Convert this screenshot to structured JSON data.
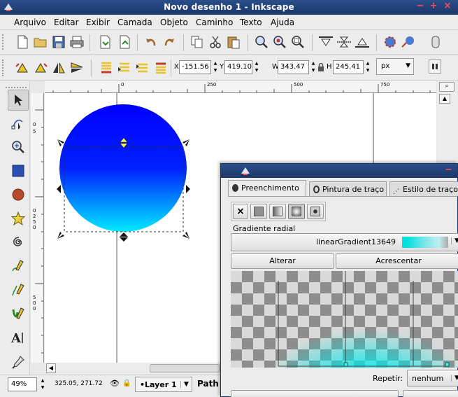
{
  "window": {
    "title": "Novo desenho 1 - Inkscape"
  },
  "menu": [
    "Arquivo",
    "Editar",
    "Exibir",
    "Camada",
    "Objeto",
    "Caminho",
    "Texto",
    "Ajuda"
  ],
  "toolbar2": {
    "x_label": "X",
    "x_value": "-151.56",
    "y_label": "Y",
    "y_value": "419.10",
    "w_label": "W",
    "w_value": "343.47",
    "h_label": "H",
    "h_value": "245.41",
    "unit": "px"
  },
  "ruler": {
    "top": [
      "0",
      "250",
      "500",
      "750"
    ],
    "left": [
      "0",
      "5",
      "0",
      "2",
      "5",
      "0",
      "5",
      "0",
      "0"
    ]
  },
  "colors": {
    "circle_top": "#0000ff",
    "circle_bottom": "#00eaff",
    "titlebar": "#1b3766"
  },
  "status": {
    "zoom": "49%",
    "coords": "325.05, 271.72",
    "layer": "•Layer 1",
    "selection": "Path"
  },
  "dialog": {
    "tabs": [
      "Preenchimento",
      "Pintura de traço",
      "Estilo de traço"
    ],
    "gradient_type_label": "Gradiente radial",
    "gradient_name": "linearGradient13649",
    "edit_button": "Alterar",
    "add_button": "Acrescentar",
    "repeat_label": "Repetir:",
    "repeat_value": "nenhum"
  },
  "icons": {
    "tools": [
      "selector-arrow-icon",
      "node-edit-icon",
      "zoom-icon",
      "rectangle-icon",
      "ellipse-icon",
      "star-icon",
      "spiral-icon",
      "pencil-icon",
      "pen-icon",
      "calligraphy-icon",
      "text-icon",
      "dropper-icon"
    ]
  }
}
